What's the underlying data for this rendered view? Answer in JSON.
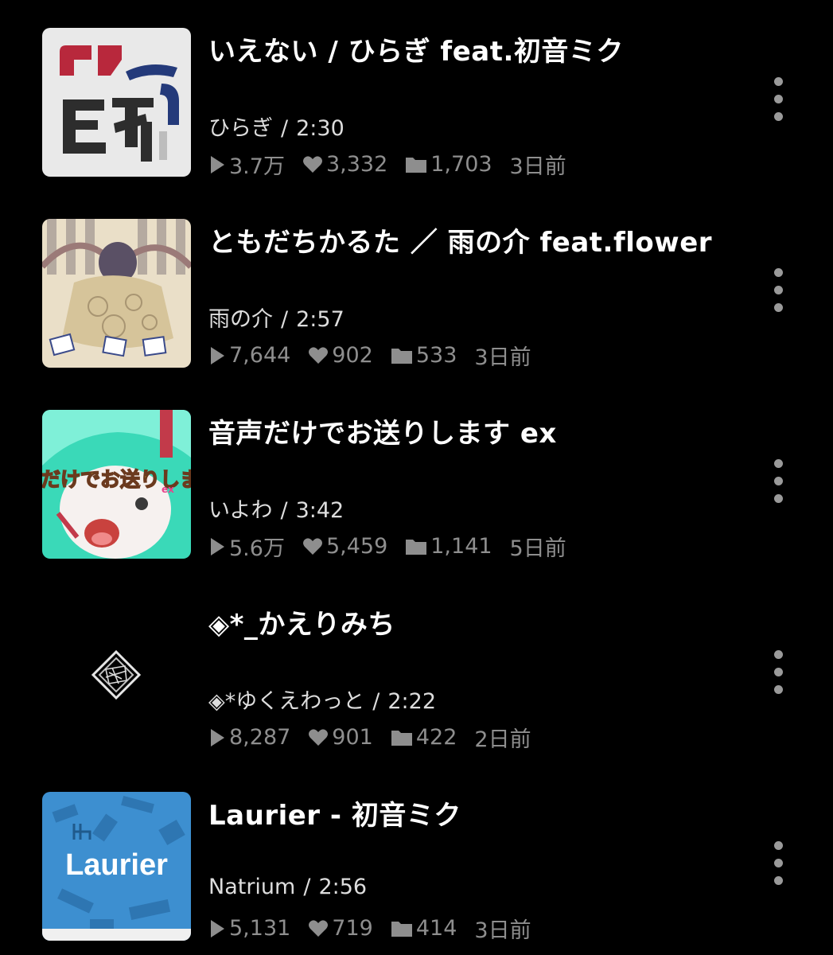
{
  "videos": [
    {
      "title": "いえない / ひらぎ feat.初音ミク",
      "author": "ひらぎ",
      "duration": "2:30",
      "plays": "3.7万",
      "likes": "3,332",
      "mylists": "1,703",
      "posted": "3日前",
      "thumbnail_icon": "eyenai-typography-thumbnail"
    },
    {
      "title": "ともだちかるた ／ 雨の介 feat.flower",
      "author": "雨の介",
      "duration": "2:57",
      "plays": "7,644",
      "likes": "902",
      "mylists": "533",
      "posted": "3日前",
      "thumbnail_icon": "kimono-character-thumbnail"
    },
    {
      "title": "音声だけでお送りします ex",
      "author": "いよわ",
      "duration": "3:42",
      "plays": "5.6万",
      "likes": "5,459",
      "mylists": "1,141",
      "posted": "5日前",
      "thumbnail_icon": "miku-character-thumbnail",
      "thumbnail_text": "だけでお送りします",
      "thumbnail_text_suffix": "ex"
    },
    {
      "title": "◈*_かえりみち",
      "author": "◈*ゆくえわっと",
      "duration": "2:22",
      "plays": "8,287",
      "likes": "901",
      "mylists": "422",
      "posted": "2日前",
      "thumbnail_icon": "diamond-scribble-thumbnail"
    },
    {
      "title": "Laurier - 初音ミク",
      "author": "Natrium",
      "duration": "2:56",
      "plays": "5,131",
      "likes": "719",
      "mylists": "414",
      "posted": "3日前",
      "thumbnail_icon": "laurier-blue-thumbnail",
      "thumbnail_text": "Laurier"
    }
  ],
  "ui": {
    "separator": "/",
    "play_icon": "play-icon",
    "like_icon": "heart-icon",
    "mylist_icon": "folder-icon",
    "more_icon": "more-vertical-icon"
  },
  "colors": {
    "background": "#000000",
    "title": "#ffffff",
    "subtitle": "#dddddd",
    "stats": "#8e8e8e",
    "laurier_blue": "#3d8fd0",
    "miku_teal": "#3ad9b8"
  }
}
